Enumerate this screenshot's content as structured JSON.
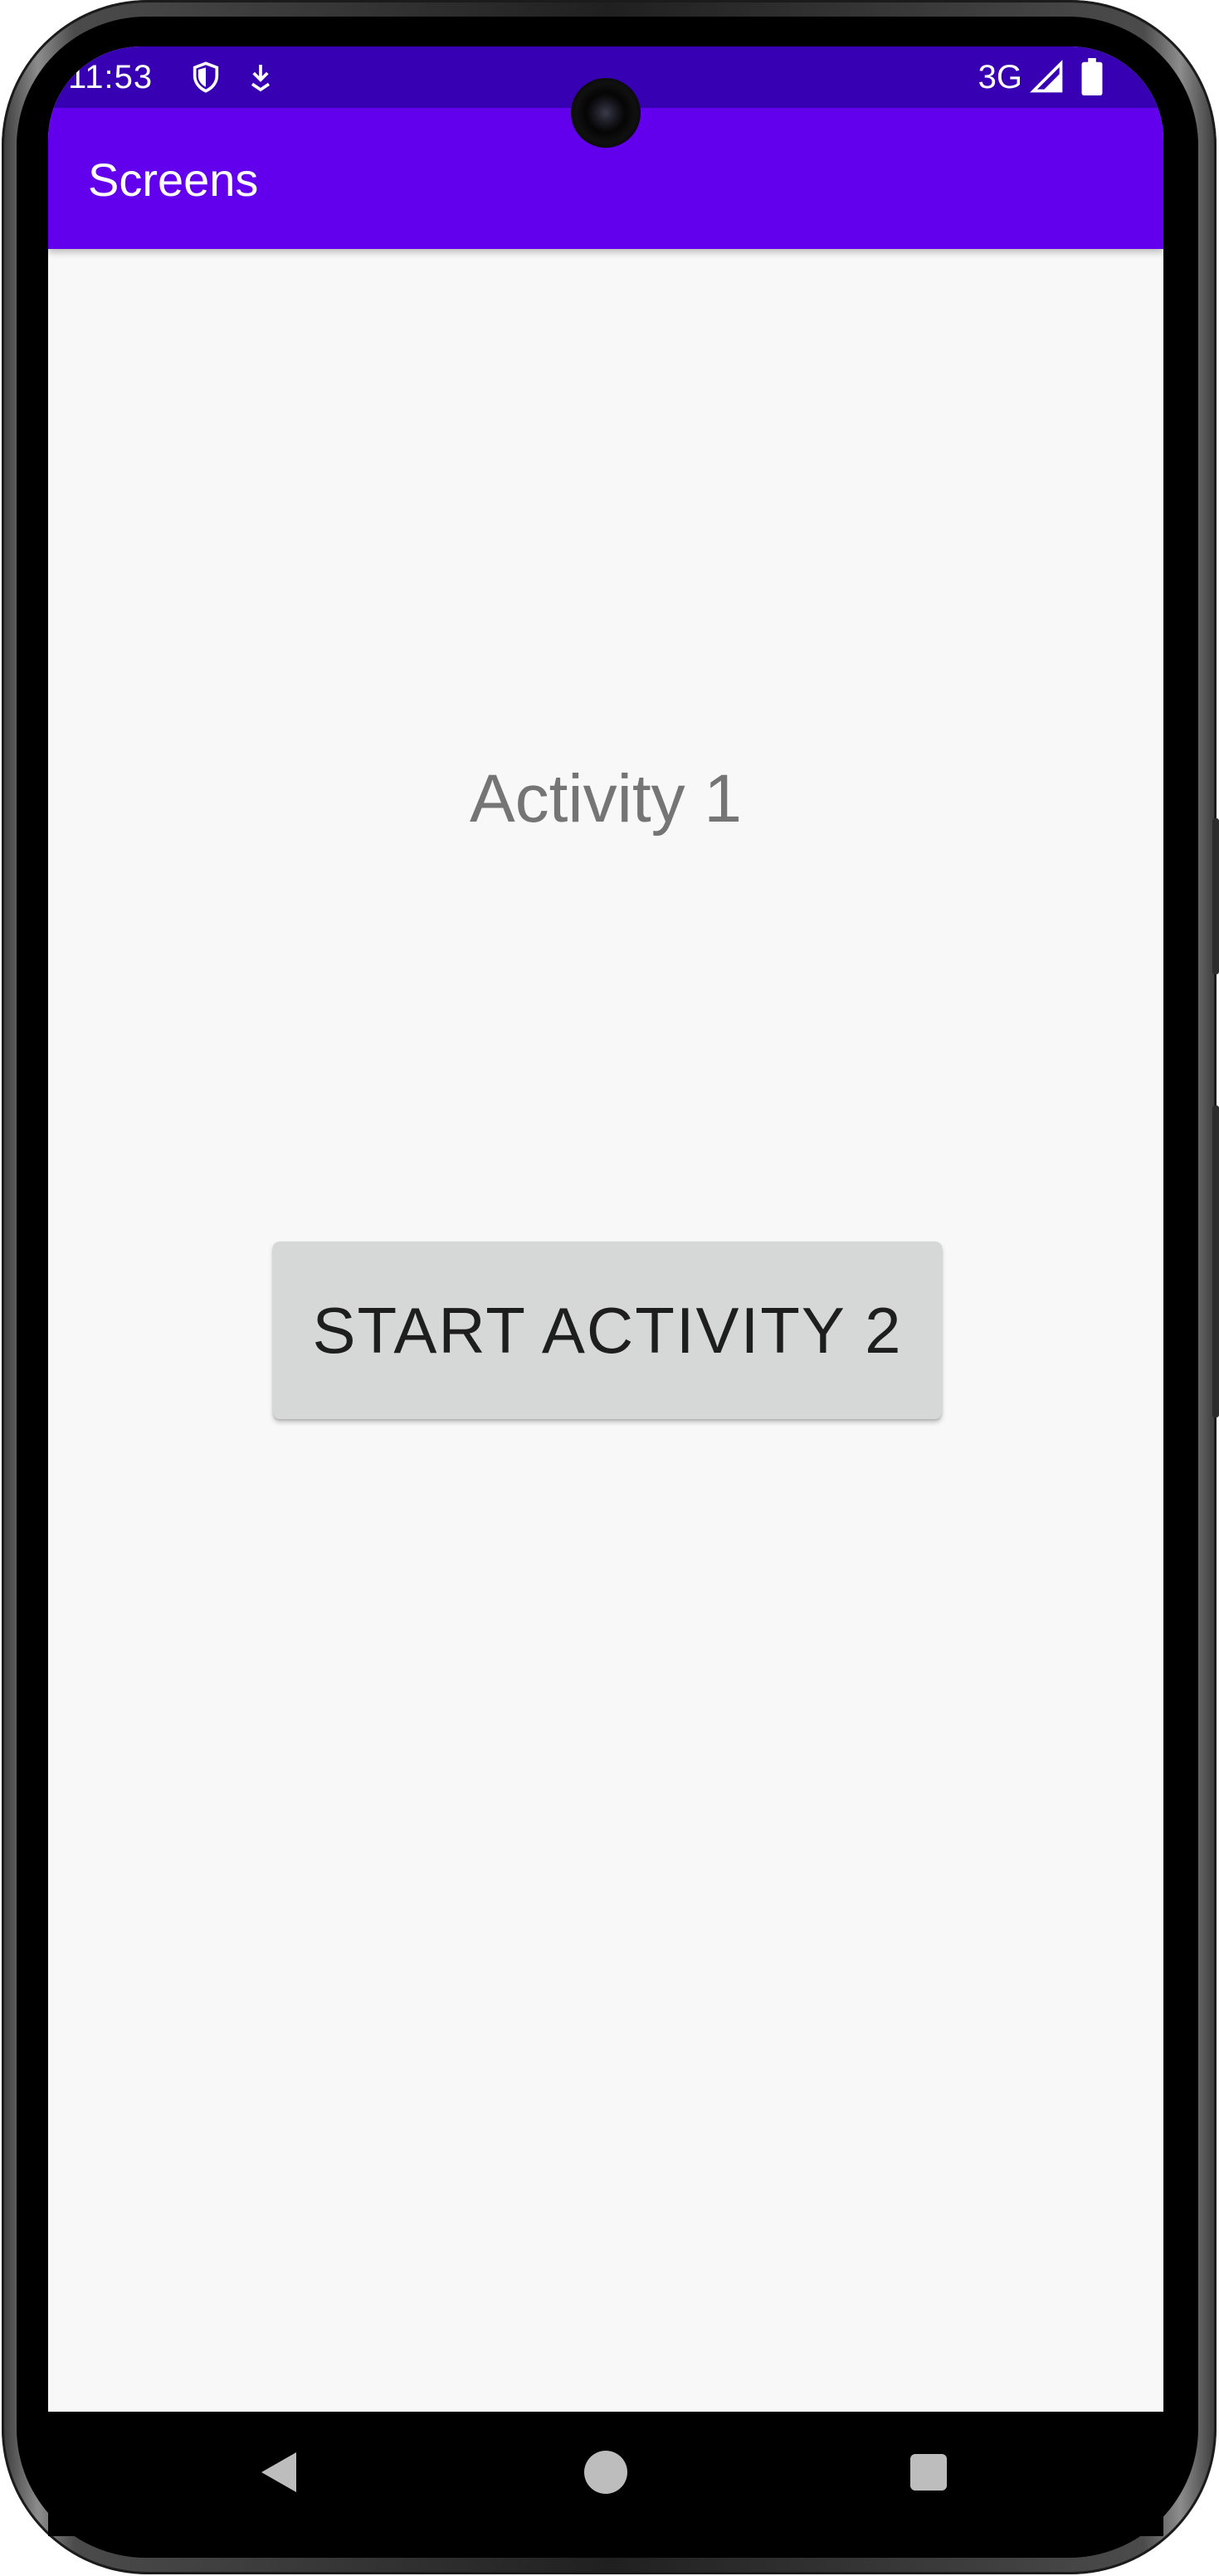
{
  "status_bar": {
    "time": "11:53",
    "network": "3G",
    "icons": [
      "shield-icon",
      "download-icon",
      "signal-icon",
      "battery-icon"
    ]
  },
  "app_bar": {
    "title": "Screens",
    "color": "#6200ee"
  },
  "main": {
    "activity_label": "Activity 1",
    "start_button_label": "START ACTIVITY 2"
  },
  "nav_bar": {
    "icons": [
      "back-icon",
      "home-icon",
      "recents-icon"
    ]
  },
  "colors": {
    "status_bar": "#3800b3",
    "app_bar": "#6200ee",
    "background": "#f8f8f8",
    "button": "#d6d7d7"
  }
}
